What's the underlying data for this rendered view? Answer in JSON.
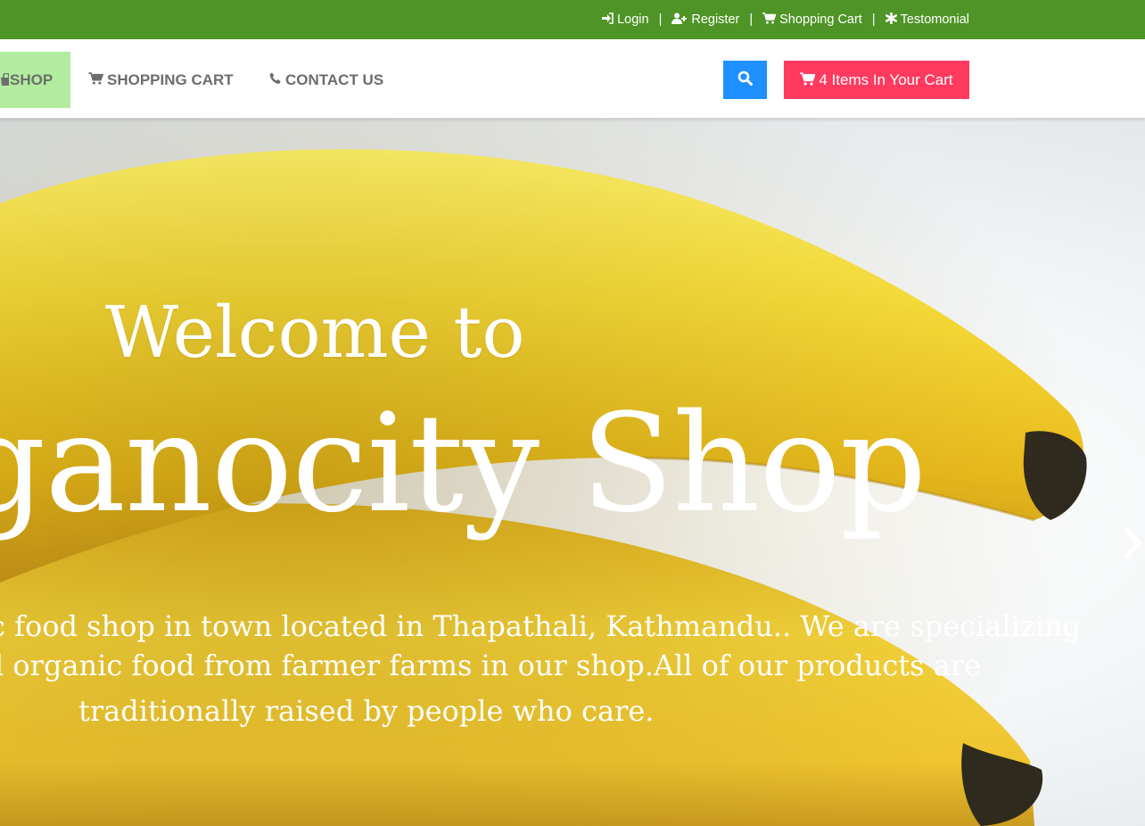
{
  "topbar": {
    "bg_color": "#4e9426",
    "links": [
      {
        "label": "Login",
        "icon": "sign-in-icon"
      },
      {
        "label": "Register",
        "icon": "user-plus-icon"
      },
      {
        "label": "Shopping Cart",
        "icon": "cart-icon"
      },
      {
        "label": "Testomonial",
        "icon": "asterisk-icon"
      }
    ],
    "separator": "|"
  },
  "nav": {
    "items": [
      {
        "label": "SHOP",
        "icon": "shop-icon",
        "active": true,
        "active_color": "#b1ec9f"
      },
      {
        "label": "SHOPPING CART",
        "icon": "cart-icon"
      },
      {
        "label": "CONTACT US",
        "icon": "phone-icon"
      }
    ],
    "search_icon": "search-icon",
    "search_color": "#1e90ff",
    "cart_button": {
      "label": "4 Items In Your Cart",
      "icon": "cart-icon",
      "color": "#fe3a5f"
    }
  },
  "hero": {
    "welcome": "Welcome to",
    "shop_name": "ganocity Shop",
    "description_lines": [
      "c food shop in town located in Thapathali, Kathmandu.. We are specializing",
      "l organic food from farmer farms in our shop.All of  our products are",
      "traditionally raised by people who care."
    ],
    "next_icon": "chevron-right-icon"
  }
}
